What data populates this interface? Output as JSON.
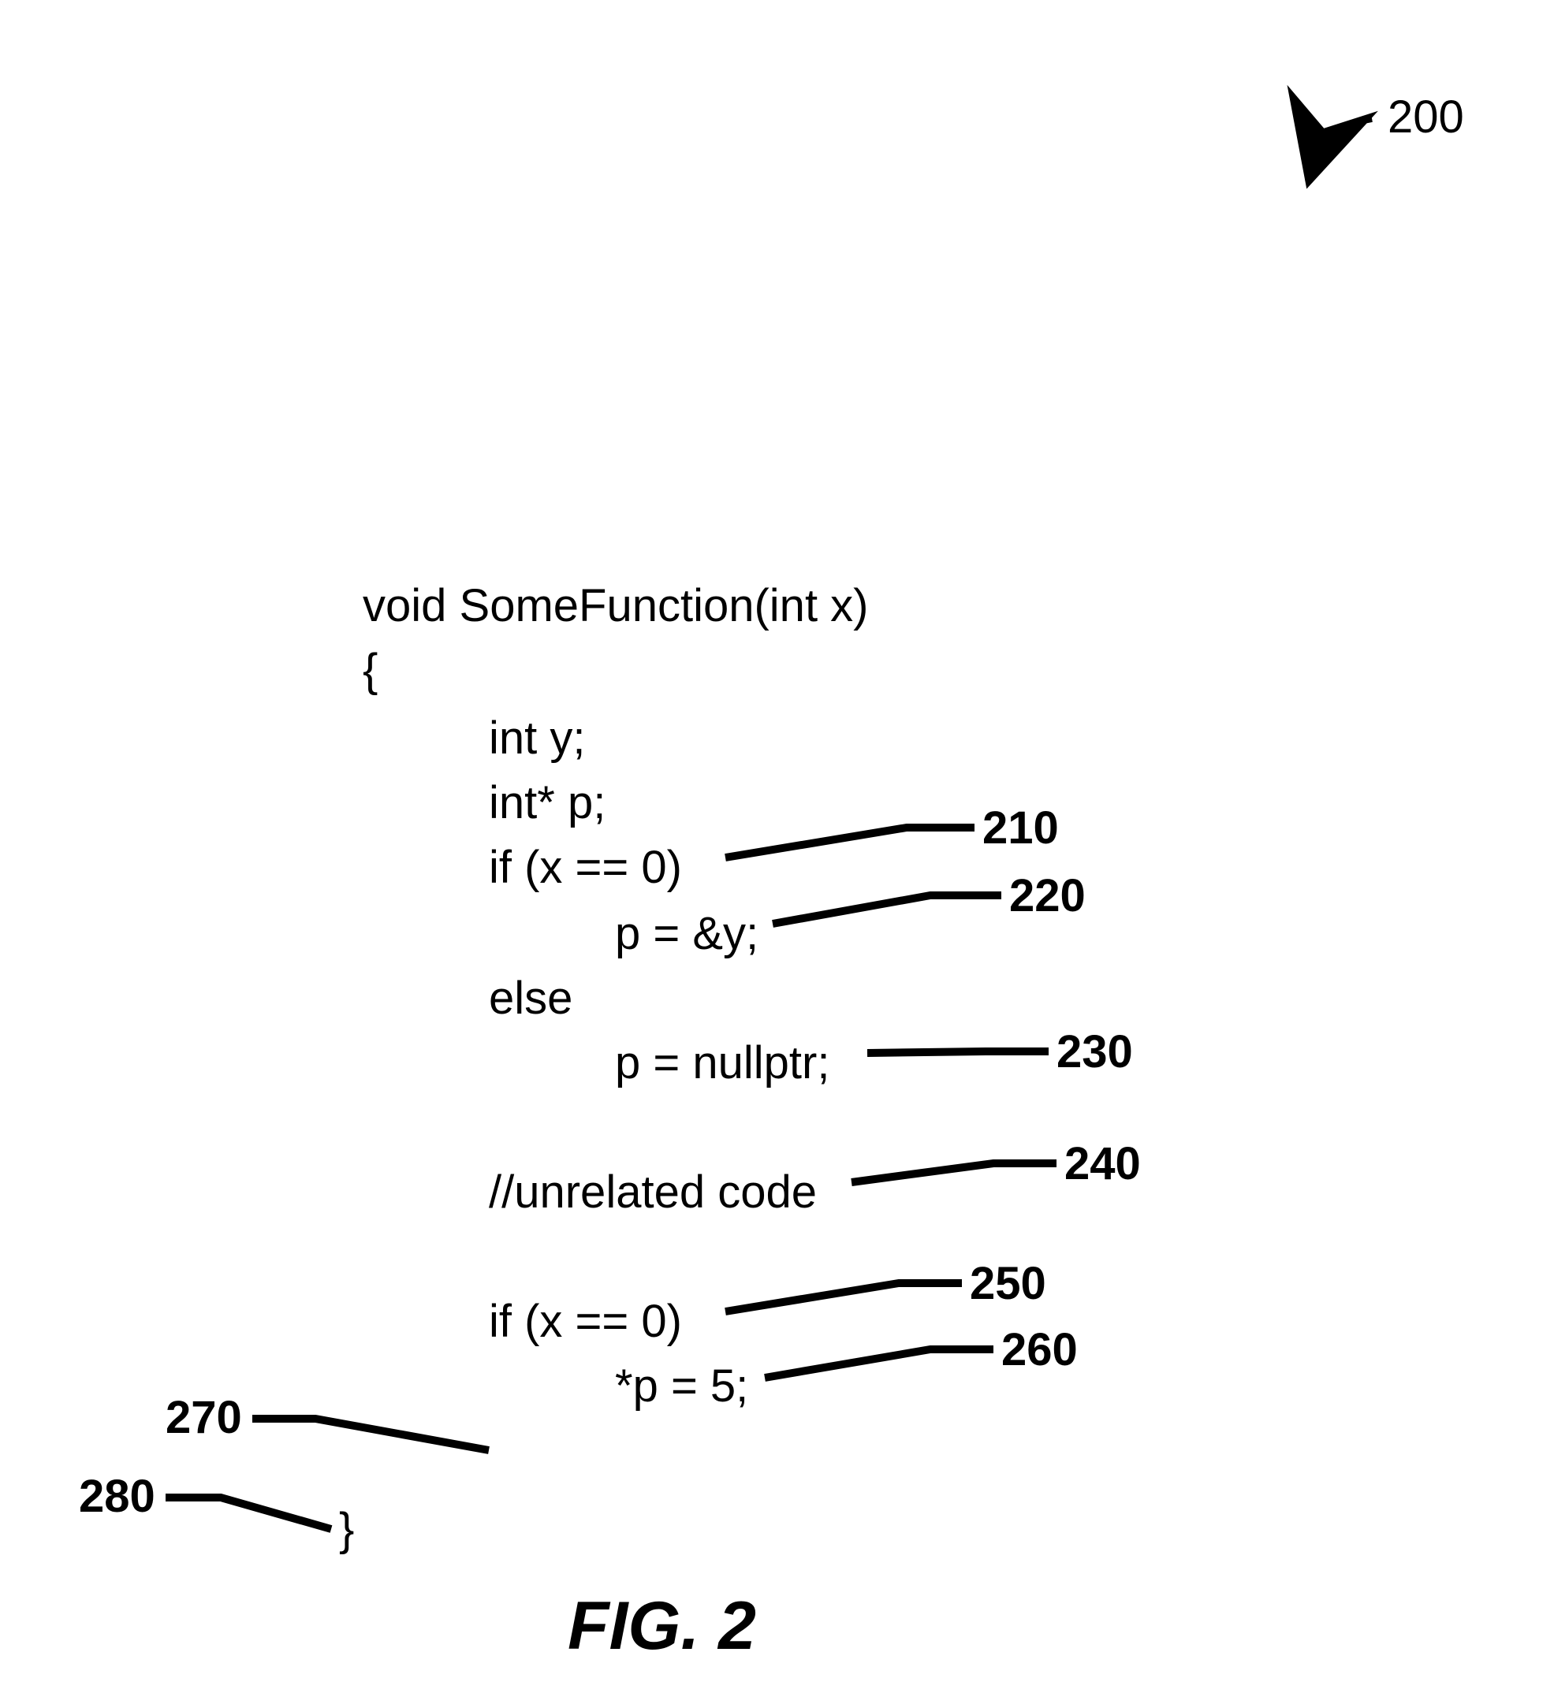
{
  "figure": {
    "ref_top": "200",
    "caption": "FIG. 2"
  },
  "code": {
    "signature": "void SomeFunction(int x)",
    "open_brace": "{",
    "decl_y": "int y;",
    "decl_p": "int* p;",
    "if1": "if (x == 0)",
    "assign_p_y": "p = &y;",
    "else_kw": "else",
    "assign_p_null": "p = nullptr;",
    "unrelated": "//unrelated code",
    "if2": "if (x == 0)",
    "deref_assign": "*p = 5;",
    "close_brace": "}"
  },
  "refs": {
    "r210": "210",
    "r220": "220",
    "r230": "230",
    "r240": "240",
    "r250": "250",
    "r260": "260",
    "r270": "270",
    "r280": "280"
  }
}
